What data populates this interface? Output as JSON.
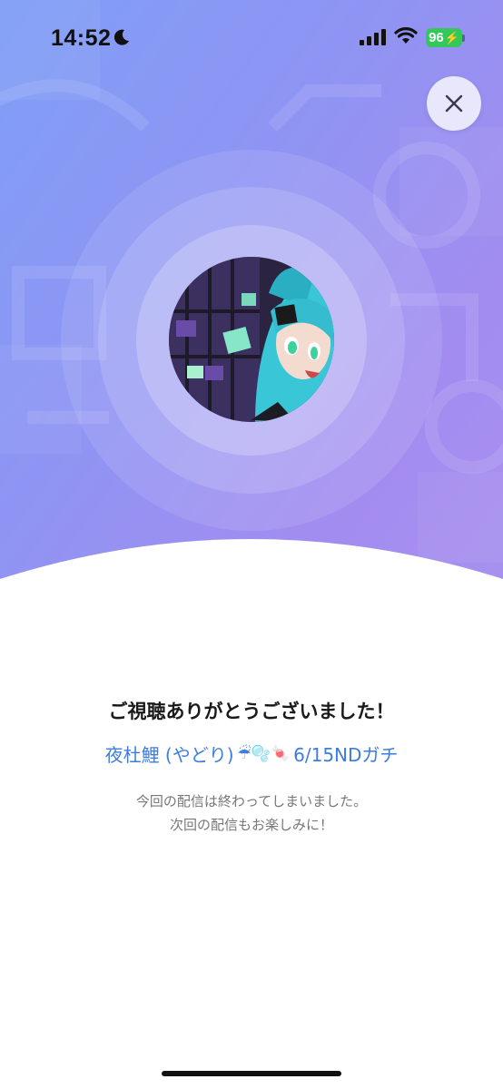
{
  "status_bar": {
    "time": "14:52",
    "battery": "96",
    "icons": [
      "moon-icon",
      "signal-icon",
      "wifi-icon",
      "battery-icon"
    ]
  },
  "close_icon": "close-icon",
  "message": {
    "thanks": "ご視聴ありがとうございました！",
    "stream_title_text": "夜杜鯉 (やどり)",
    "stream_title_emojis": "☔🫧🍬",
    "stream_title_suffix": "6/15NDガチ",
    "ended_line1": "今回の配信は終わってしまいました。",
    "ended_line2": "次回の配信もお楽しみに！"
  },
  "colors": {
    "accent_link": "#3d7de0",
    "hero_gradient_start": "#7f9ff6",
    "hero_gradient_end": "#a892ee",
    "battery_green": "#34c759"
  }
}
